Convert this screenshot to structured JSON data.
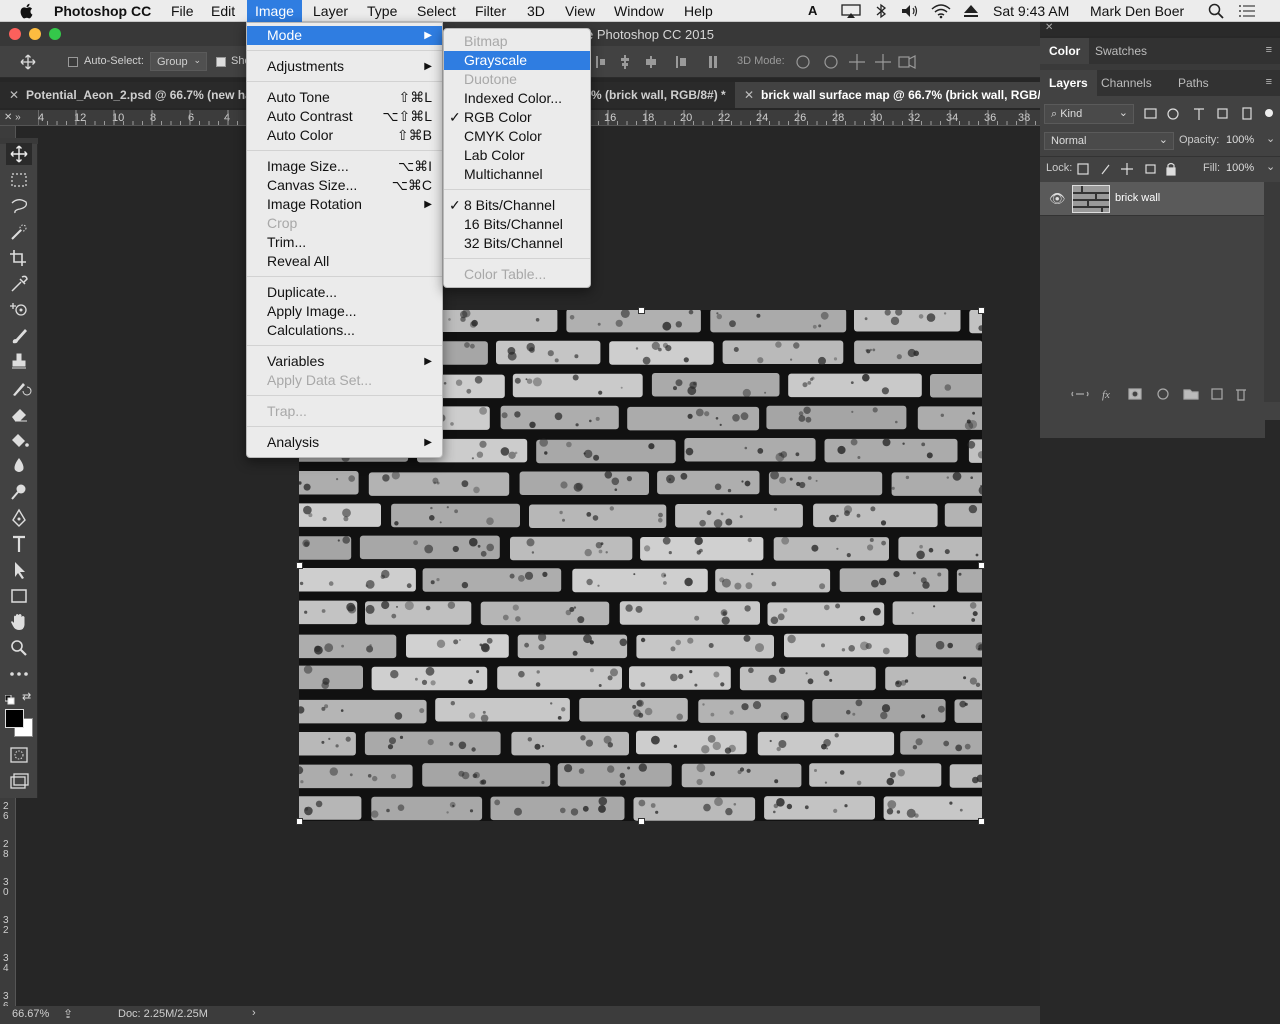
{
  "menubar": {
    "app_name": "Photoshop CC",
    "items": [
      "File",
      "Edit",
      "Image",
      "Layer",
      "Type",
      "Select",
      "Filter",
      "3D",
      "View",
      "Window",
      "Help"
    ],
    "active_item": "Image",
    "clock": "Sat 9:43 AM",
    "user": "Mark Den Boer"
  },
  "window": {
    "title": "e Photoshop CC 2015"
  },
  "options_bar": {
    "auto_select_label": "Auto-Select:",
    "auto_select_value": "Group",
    "show_label": "Sho",
    "mode_3d_label": "3D Mode:"
  },
  "doc_tabs": [
    {
      "label": "Potential_Aeon_2.psd @ 66.7% (new hai",
      "active": false
    },
    {
      "label": "% (brick wall, RGB/8#) *",
      "active": false
    },
    {
      "label": "brick wall surface map @ 66.7% (brick wall, RGB/8",
      "active": true
    }
  ],
  "rulers": {
    "h_ticks": [
      "4",
      "12",
      "10",
      "8",
      "6",
      "4",
      "16",
      "18",
      "20",
      "22",
      "24",
      "26",
      "28",
      "30",
      "32",
      "34",
      "36",
      "38"
    ],
    "v_ticks": [
      "2\n6",
      "2\n8",
      "3\n0",
      "3\n2",
      "3\n4",
      "3\n6"
    ]
  },
  "image_menu": {
    "items": [
      {
        "label": "Mode",
        "type": "submenu",
        "highlighted": true
      },
      {
        "type": "sep"
      },
      {
        "label": "Adjustments",
        "type": "submenu"
      },
      {
        "type": "sep"
      },
      {
        "label": "Auto Tone",
        "shortcut": "⇧⌘L"
      },
      {
        "label": "Auto Contrast",
        "shortcut": "⌥⇧⌘L"
      },
      {
        "label": "Auto Color",
        "shortcut": "⇧⌘B"
      },
      {
        "type": "sep"
      },
      {
        "label": "Image Size...",
        "shortcut": "⌥⌘I"
      },
      {
        "label": "Canvas Size...",
        "shortcut": "⌥⌘C"
      },
      {
        "label": "Image Rotation",
        "type": "submenu"
      },
      {
        "label": "Crop",
        "disabled": true
      },
      {
        "label": "Trim..."
      },
      {
        "label": "Reveal All"
      },
      {
        "type": "sep"
      },
      {
        "label": "Duplicate..."
      },
      {
        "label": "Apply Image..."
      },
      {
        "label": "Calculations..."
      },
      {
        "type": "sep"
      },
      {
        "label": "Variables",
        "type": "submenu"
      },
      {
        "label": "Apply Data Set...",
        "disabled": true
      },
      {
        "type": "sep"
      },
      {
        "label": "Trap...",
        "disabled": true
      },
      {
        "type": "sep"
      },
      {
        "label": "Analysis",
        "type": "submenu"
      }
    ]
  },
  "mode_menu": {
    "items": [
      {
        "label": "Bitmap",
        "disabled": true
      },
      {
        "label": "Grayscale",
        "highlighted": true
      },
      {
        "label": "Duotone",
        "disabled": true
      },
      {
        "label": "Indexed Color..."
      },
      {
        "label": "RGB Color",
        "checked": true
      },
      {
        "label": "CMYK Color"
      },
      {
        "label": "Lab Color"
      },
      {
        "label": "Multichannel"
      },
      {
        "type": "sep"
      },
      {
        "label": "8 Bits/Channel",
        "checked": true
      },
      {
        "label": "16 Bits/Channel"
      },
      {
        "label": "32 Bits/Channel"
      },
      {
        "type": "sep"
      },
      {
        "label": "Color Table...",
        "disabled": true
      }
    ]
  },
  "panels": {
    "color_tabs": [
      "Color",
      "Swatches"
    ],
    "layers_tabs": [
      "Layers",
      "Channels",
      "Paths"
    ],
    "kind_filter": "Kind",
    "blend_mode": "Normal",
    "opacity_label": "Opacity:",
    "opacity_value": "100%",
    "lock_label": "Lock:",
    "fill_label": "Fill:",
    "fill_value": "100%",
    "layer_name": "brick wall"
  },
  "status": {
    "zoom": "66.67%",
    "doc": "Doc: 2.25M/2.25M"
  },
  "colors": {
    "accent": "#2f7de1",
    "panel": "#424242",
    "canvas": "#262626"
  }
}
